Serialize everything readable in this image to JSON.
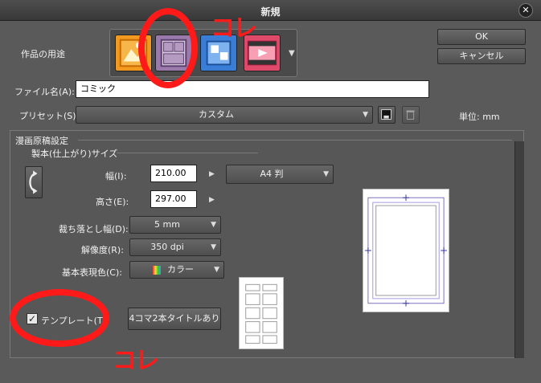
{
  "window": {
    "title": "新規",
    "close_glyph": "✕"
  },
  "usage": {
    "label": "作品の用途",
    "icons": [
      "illustration-icon",
      "comic-icon",
      "webtoon-icon",
      "animation-icon"
    ],
    "selected": "comic-icon"
  },
  "buttons": {
    "ok": "OK",
    "cancel": "キャンセル"
  },
  "file_name": {
    "label": "ファイル名(A):",
    "value": "コミック"
  },
  "preset": {
    "label": "プリセット(S):",
    "value": "カスタム",
    "unit_label": "単位:",
    "unit_value": "mm"
  },
  "manga": {
    "section_title": "漫画原稿設定",
    "subsection_title": "製本(仕上がり)サイズ",
    "width": {
      "label": "幅(I):",
      "value": "210.00"
    },
    "height": {
      "label": "高さ(E):",
      "value": "297.00"
    },
    "paper_size": "A4 判",
    "bleed": {
      "label": "裁ち落とし幅(D):",
      "value": "5 mm"
    },
    "resolution": {
      "label": "解像度(R):",
      "value": "350 dpi"
    },
    "color": {
      "label": "基本表現色(C):",
      "value": "カラー"
    }
  },
  "template": {
    "label": "テンプレート(T)",
    "checked": true,
    "check_glyph": "✓",
    "button": "4コマ2本タイトルあり"
  },
  "annotations": {
    "text": "コレ",
    "color": "#ff1a1a"
  },
  "colors": {
    "dialog_bg": "#5a5a5a",
    "titlebar": "#3c3c3c",
    "selected_icon": "#9a7aaa"
  }
}
